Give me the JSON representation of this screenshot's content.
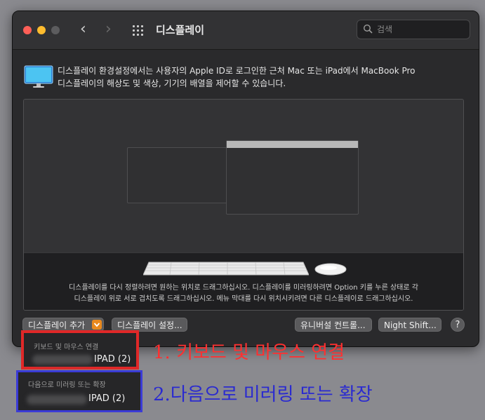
{
  "window": {
    "title": "디스플레이",
    "search_placeholder": "검색"
  },
  "description": {
    "line1": "디스플레이 환경설정에서는 사용자의 Apple ID로 로그인한 근처 Mac 또는 iPad에서 MacBook Pro",
    "line2": "디스플레이의 해상도 및 색상, 기기의 배열을 제어할 수 있습니다."
  },
  "arrangement": {
    "hint_line1": "디스플레이를 다시 정렬하려면 원하는 위치로 드래그하십시오. 디스플레이를 미러링하려면 Option 키를 누른 상태로 각",
    "hint_line2": "디스플레이 위로 서로 겹치도록 드래그하십시오. 메뉴 막대를 다시 위치시키려면 다른 디스플레이로 드래그하십시오."
  },
  "buttons": {
    "add_display": "디스플레이 추가",
    "display_settings": "디스플레이 설정...",
    "universal_control": "유니버설 컨트롤...",
    "night_shift": "Night Shift...",
    "help": "?"
  },
  "menu": {
    "section1_header": "키보드 및 마우스 연결",
    "section1_item": "IPAD (2)",
    "section2_header": "다음으로 미러링 또는 확장",
    "section2_item": "IPAD (2)"
  },
  "annotations": {
    "note1": "1. 키보드 및 마우스 연결",
    "note2": "2.다음으로 미러링 또는 확장"
  },
  "colors": {
    "accent_orange": "#e8891e",
    "annotation_red": "#ff3030",
    "annotation_blue": "#2a2ad0"
  }
}
